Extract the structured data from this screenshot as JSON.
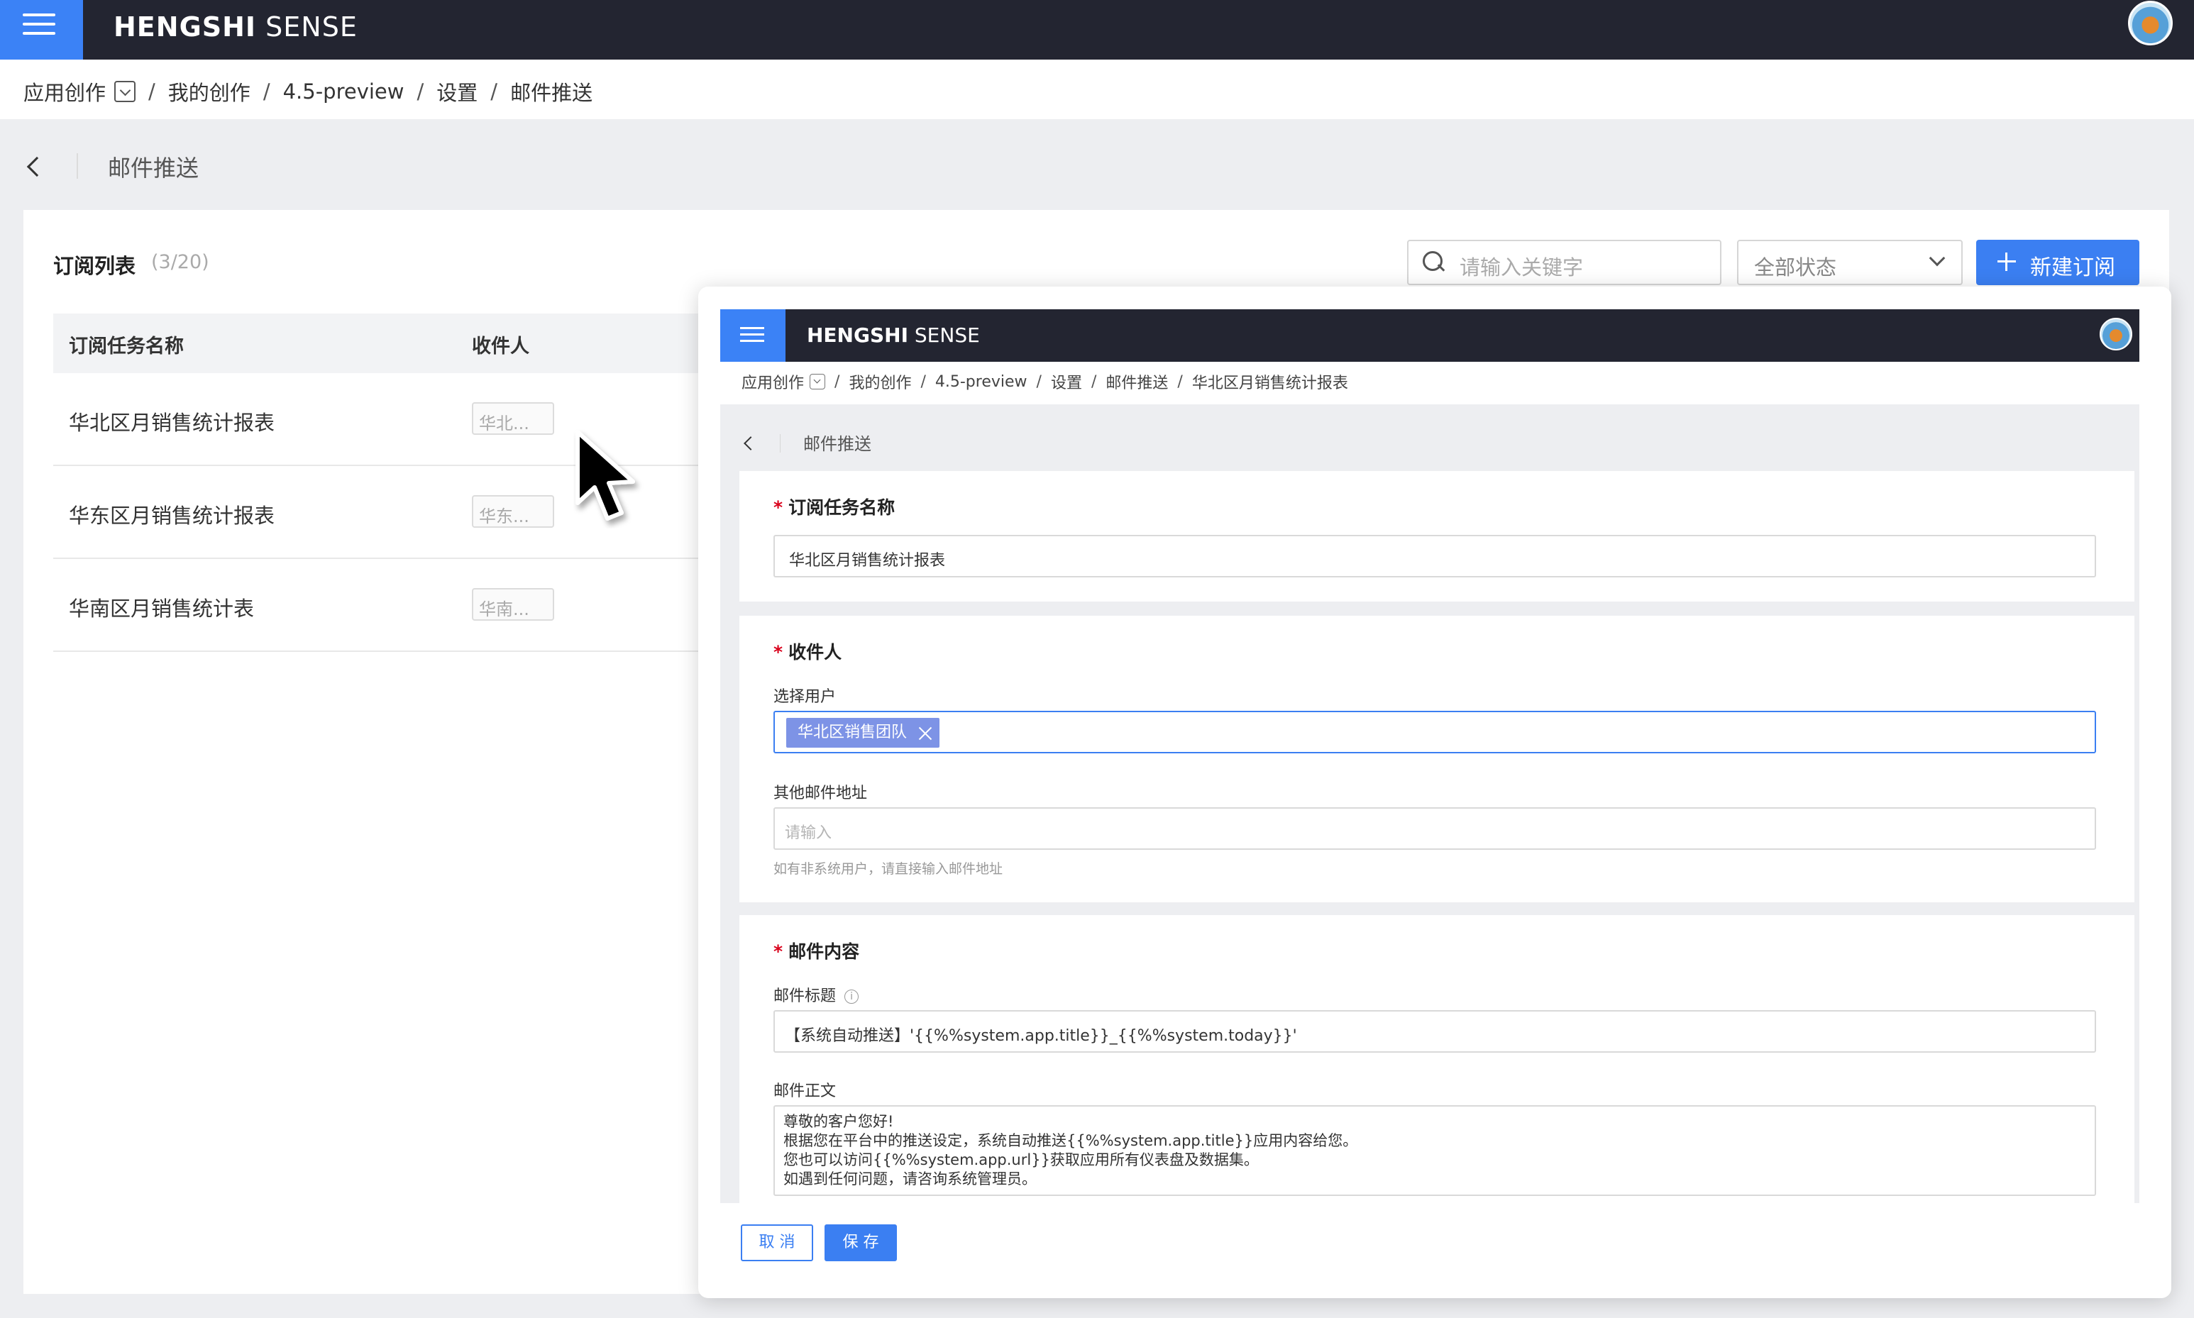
{
  "app": {
    "brand_bold": "HENGSHI",
    "brand_light": "SENSE"
  },
  "breadcrumb": [
    "应用创作",
    "我的创作",
    "4.5-preview",
    "设置",
    "邮件推送"
  ],
  "page": {
    "title": "邮件推送"
  },
  "list": {
    "title": "订阅列表",
    "count": "(3/20)",
    "search_placeholder": "请输入关键字",
    "status_filter": "全部状态",
    "new_button": "新建订阅",
    "columns": [
      "订阅任务名称",
      "收件人"
    ],
    "rows": [
      {
        "name": "华北区月销售统计报表",
        "recipient": "华北..."
      },
      {
        "name": "华东区月销售统计报表",
        "recipient": "华东..."
      },
      {
        "name": "华南区月销售统计表",
        "recipient": "华南..."
      }
    ]
  },
  "modal": {
    "breadcrumb": [
      "应用创作",
      "我的创作",
      "4.5-preview",
      "设置",
      "邮件推送",
      "华北区月销售统计报表"
    ],
    "page_title": "邮件推送",
    "task_section": {
      "label": "订阅任务名称",
      "value": "华北区月销售统计报表"
    },
    "recipient_section": {
      "label": "收件人",
      "select_user_label": "选择用户",
      "selected_tag": "华北区销售团队",
      "other_email_label": "其他邮件地址",
      "other_email_placeholder": "请输入",
      "other_email_hint": "如有非系统用户，请直接输入邮件地址"
    },
    "content_section": {
      "label": "邮件内容",
      "subject_label": "邮件标题",
      "subject_value": "【系统自动推送】'{{%%system.app.title}}_{{%%system.today}}'",
      "body_label": "邮件正文",
      "body_lines": [
        "尊敬的客户您好!",
        "  根据您在平台中的推送设定，系统自动推送{{%%system.app.title}}应用内容给您。",
        "  您也可以访问{{%%system.app.url}}获取应用所有仪表盘及数据集。",
        "  如遇到任何问题，请咨询系统管理员。"
      ]
    },
    "buttons": {
      "cancel": "取 消",
      "save": "保 存"
    }
  },
  "icons": [
    "hamburger-icon",
    "chevron-down-icon",
    "back-chevron-icon",
    "search-icon",
    "plus-icon",
    "close-icon",
    "info-icon",
    "mouse-pointer-icon"
  ],
  "colors": {
    "accent": "#3b7ff2",
    "topbar": "#232531",
    "tag": "#7d93e6",
    "required": "#d9001b"
  }
}
